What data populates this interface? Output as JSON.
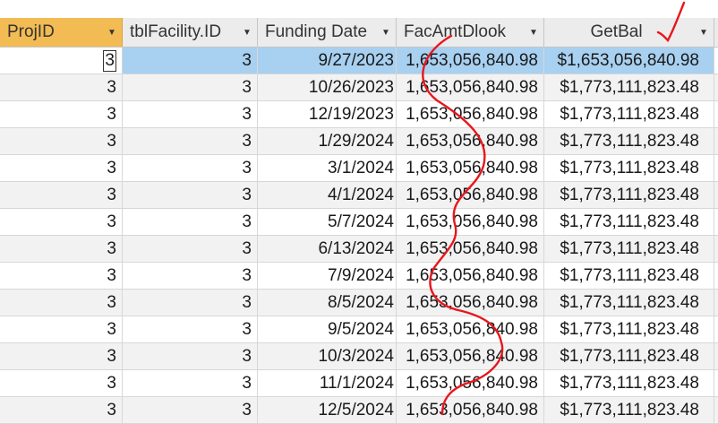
{
  "columns": [
    {
      "label": "ProjID",
      "dropdown_icon": "dropdown-arrow-icon"
    },
    {
      "label": "tblFacility.ID",
      "dropdown_icon": "dropdown-arrow-icon"
    },
    {
      "label": "Funding Date",
      "dropdown_icon": "dropdown-arrow-icon"
    },
    {
      "label": "FacAmtDlook",
      "dropdown_icon": "dropdown-arrow-icon"
    },
    {
      "label": "GetBal",
      "dropdown_icon": "dropdown-arrow-icon"
    }
  ],
  "rows": [
    {
      "proj_id": "3",
      "facility_id": "3",
      "funding_date": "9/27/2023",
      "fac_amt": "1,653,056,840.98",
      "get_bal": "$1,653,056,840.98"
    },
    {
      "proj_id": "3",
      "facility_id": "3",
      "funding_date": "10/26/2023",
      "fac_amt": "1,653,056,840.98",
      "get_bal": "$1,773,111,823.48"
    },
    {
      "proj_id": "3",
      "facility_id": "3",
      "funding_date": "12/19/2023",
      "fac_amt": "1,653,056,840.98",
      "get_bal": "$1,773,111,823.48"
    },
    {
      "proj_id": "3",
      "facility_id": "3",
      "funding_date": "1/29/2024",
      "fac_amt": "1,653,056,840.98",
      "get_bal": "$1,773,111,823.48"
    },
    {
      "proj_id": "3",
      "facility_id": "3",
      "funding_date": "3/1/2024",
      "fac_amt": "1,653,056,840.98",
      "get_bal": "$1,773,111,823.48"
    },
    {
      "proj_id": "3",
      "facility_id": "3",
      "funding_date": "4/1/2024",
      "fac_amt": "1,653,056,840.98",
      "get_bal": "$1,773,111,823.48"
    },
    {
      "proj_id": "3",
      "facility_id": "3",
      "funding_date": "5/7/2024",
      "fac_amt": "1,653,056,840.98",
      "get_bal": "$1,773,111,823.48"
    },
    {
      "proj_id": "3",
      "facility_id": "3",
      "funding_date": "6/13/2024",
      "fac_amt": "1,653,056,840.98",
      "get_bal": "$1,773,111,823.48"
    },
    {
      "proj_id": "3",
      "facility_id": "3",
      "funding_date": "7/9/2024",
      "fac_amt": "1,653,056,840.98",
      "get_bal": "$1,773,111,823.48"
    },
    {
      "proj_id": "3",
      "facility_id": "3",
      "funding_date": "8/5/2024",
      "fac_amt": "1,653,056,840.98",
      "get_bal": "$1,773,111,823.48"
    },
    {
      "proj_id": "3",
      "facility_id": "3",
      "funding_date": "9/5/2024",
      "fac_amt": "1,653,056,840.98",
      "get_bal": "$1,773,111,823.48"
    },
    {
      "proj_id": "3",
      "facility_id": "3",
      "funding_date": "10/3/2024",
      "fac_amt": "1,653,056,840.98",
      "get_bal": "$1,773,111,823.48"
    },
    {
      "proj_id": "3",
      "facility_id": "3",
      "funding_date": "11/1/2024",
      "fac_amt": "1,653,056,840.98",
      "get_bal": "$1,773,111,823.48"
    },
    {
      "proj_id": "3",
      "facility_id": "3",
      "funding_date": "12/5/2024",
      "fac_amt": "1,653,056,840.98",
      "get_bal": "$1,773,111,823.48"
    }
  ],
  "colors": {
    "active_header": "#f3bb53",
    "selected_row": "#a8d0f0",
    "annotation_ink": "#e8161c"
  }
}
